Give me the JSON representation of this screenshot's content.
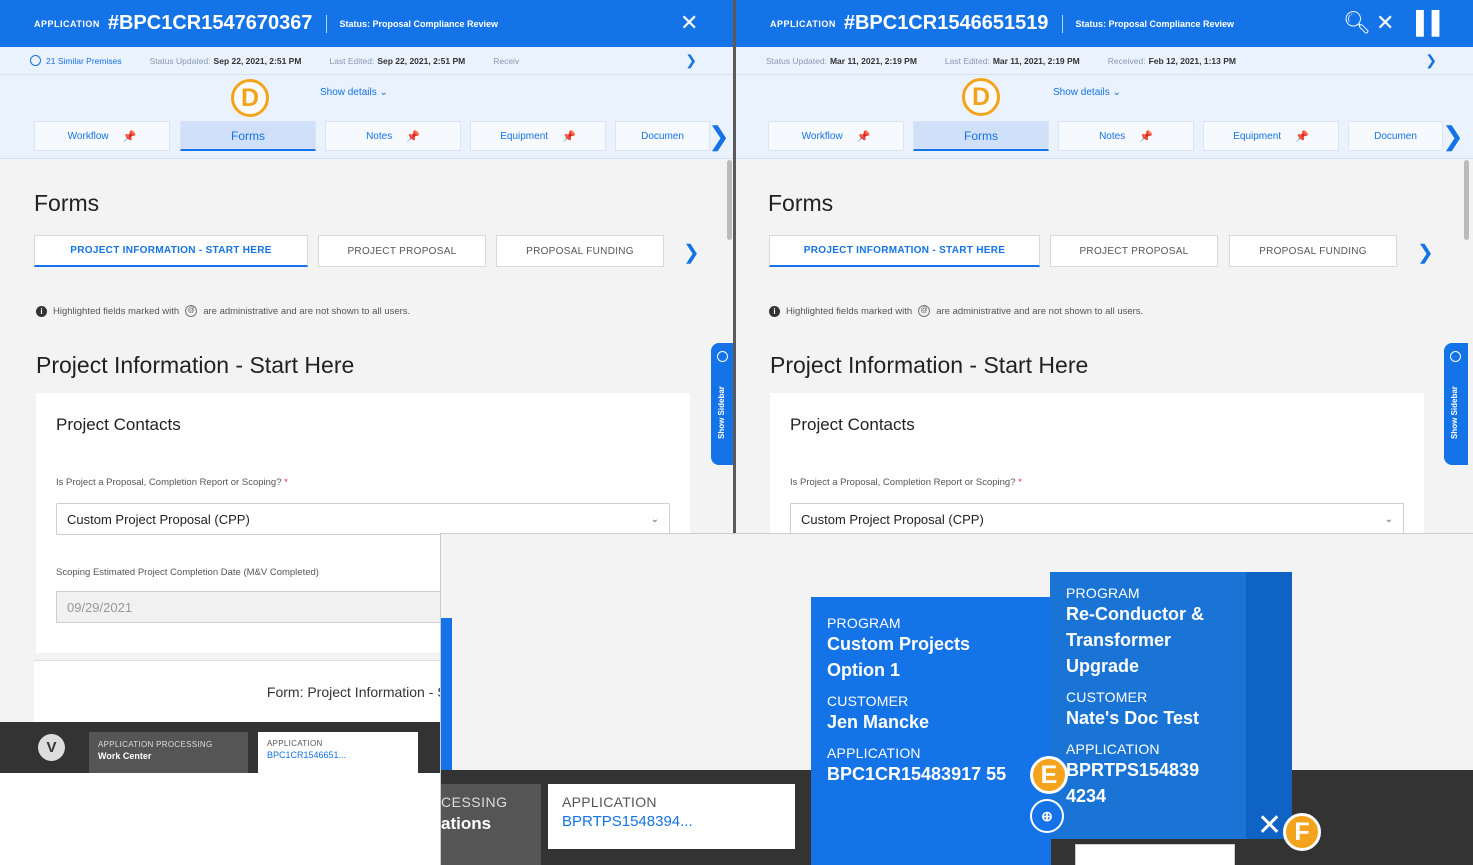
{
  "left": {
    "app_label": "APPLICATION",
    "app_number": "#BPC1CR1547670367",
    "status": "Status: Proposal Compliance Review",
    "similar": "21 Similar Premises",
    "status_updated_label": "Status Updated:",
    "status_updated": "Sep 22, 2021, 2:51 PM",
    "last_edited_label": "Last Edited:",
    "last_edited": "Sep 22, 2021, 2:51 PM",
    "received_label": "Receiv",
    "show_details": "Show details",
    "tabs": [
      "Workflow",
      "Forms",
      "Notes",
      "Equipment",
      "Documen"
    ],
    "content_title": "Forms",
    "subtabs": [
      "PROJECT INFORMATION - START HERE",
      "PROJECT PROPOSAL",
      "PROPOSAL FUNDING"
    ],
    "notice_pre": "Highlighted fields marked with",
    "notice_post": "are administrative and are not shown to all users.",
    "section_title": "Project Information - Start Here",
    "card_title": "Project Contacts",
    "q1": "Is Project a Proposal, Completion Report or Scoping?",
    "q1_required": "*",
    "q1_value": "Custom Project Proposal (CPP)",
    "q2": "Scoping Estimated Project Completion Date (M&V Completed)",
    "q2_value": "09/29/2021",
    "footer_text": "Form: Project Information - Start Here",
    "sidebar_label": "Show Sidebar",
    "taskbar": {
      "wc_line1": "APPLICATION PROCESSING",
      "wc_line2": "Work Center",
      "app_line1": "APPLICATION",
      "app_line2": "BPC1CR1546651..."
    }
  },
  "right": {
    "app_label": "APPLICATION",
    "app_number": "#BPC1CR1546651519",
    "status": "Status: Proposal Compliance Review",
    "status_updated_label": "Status Updated:",
    "status_updated": "Mar 11, 2021, 2:19 PM",
    "last_edited_label": "Last Edited:",
    "last_edited": "Mar 11, 2021, 2:19 PM",
    "received_label": "Received:",
    "received": "Feb 12, 2021, 1:13 PM",
    "show_details": "Show details",
    "tabs": [
      "Workflow",
      "Forms",
      "Notes",
      "Equipment",
      "Documen"
    ],
    "content_title": "Forms",
    "subtabs": [
      "PROJECT INFORMATION - START HERE",
      "PROJECT PROPOSAL",
      "PROPOSAL FUNDING"
    ],
    "notice_pre": "Highlighted fields marked with",
    "notice_post": "are administrative and are not shown to all users.",
    "section_title": "Project Information - Start Here",
    "card_title": "Project Contacts",
    "q1": "Is Project a Proposal, Completion Report or Scoping?",
    "q1_required": "*",
    "q1_value": "Custom Project Proposal (CPP)",
    "sidebar_label": "Show Sidebar"
  },
  "zoom": {
    "wc_line1": "CESSING",
    "wc_line2": "ations",
    "app_line1": "APPLICATION",
    "app_line2": "BPRTPS1548394...",
    "tile_a": {
      "program_label": "PROGRAM",
      "program": "Custom Projects Option 1",
      "customer_label": "CUSTOMER",
      "customer": "Jen Mancke",
      "application_label": "APPLICATION",
      "application": "BPC1CR15483917 55"
    },
    "tile_b": {
      "program_label": "PROGRAM",
      "program": "Re-Conductor & Transformer Upgrade",
      "customer_label": "CUSTOMER",
      "customer": "Nate's Doc Test",
      "application_label": "APPLICATION",
      "application": "BPRTPS154839 4234"
    }
  },
  "callouts": {
    "d": "D",
    "e": "E",
    "f": "F"
  },
  "icons": {
    "close": "close-icon",
    "search": "search-icon",
    "pin": "pin-icon",
    "link": "link-icon",
    "chevron": "chevron-right-icon"
  },
  "colors": {
    "accent": "#1473e6",
    "callout": "#f4a41c",
    "taskbar": "#333333"
  }
}
